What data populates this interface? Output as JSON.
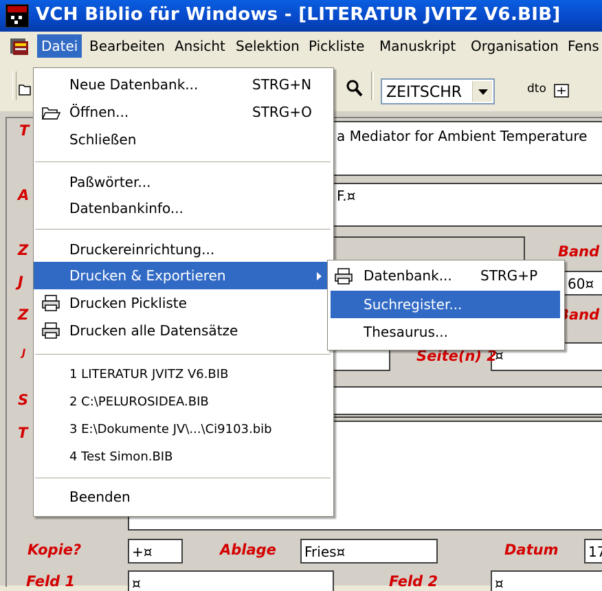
{
  "window": {
    "title": "VCH Biblio für Windows - [LITERATUR JVITZ V6.BIB]"
  },
  "menubar": {
    "items": [
      {
        "label": "Datei"
      },
      {
        "label": "Bearbeiten"
      },
      {
        "label": "Ansicht"
      },
      {
        "label": "Selektion"
      },
      {
        "label": "Pickliste"
      },
      {
        "label": "Manuskript"
      },
      {
        "label": "Organisation"
      },
      {
        "label": "Fens"
      }
    ]
  },
  "toolbar": {
    "field_combo_value": "ZEITSCHR",
    "dto_label": "dto"
  },
  "datei_menu": {
    "new_db": {
      "label": "Neue Datenbank...",
      "shortcut": "STRG+N"
    },
    "open": {
      "label": "Öffnen...",
      "shortcut": "STRG+O"
    },
    "close": {
      "label": "Schließen"
    },
    "passwords": {
      "label": "Paßwörter..."
    },
    "dbinfo": {
      "label": "Datenbankinfo..."
    },
    "printer_setup": {
      "label": "Druckereinrichtung..."
    },
    "print_export": {
      "label": "Drucken & Exportieren"
    },
    "print_picklist": {
      "label": "Drucken Pickliste"
    },
    "print_all": {
      "label": "Drucken alle Datensätze"
    },
    "recent": [
      {
        "label": "1 LITERATUR JVITZ V6.BIB"
      },
      {
        "label": "2 C:\\PELUROSIDEA.BIB"
      },
      {
        "label": "3 E:\\Dokumente JV\\...\\Ci9103.bib"
      },
      {
        "label": "4 Test Simon.BIB"
      }
    ],
    "exit": {
      "label": "Beenden"
    }
  },
  "export_submenu": {
    "database": {
      "label": "Datenbank...",
      "shortcut": "STRG+P"
    },
    "search_index": {
      "label": "Suchregister..."
    },
    "thesaurus": {
      "label": "Thesaurus..."
    }
  },
  "form": {
    "title_text": "a Mediator for Ambient Temperature",
    "author_text": "F.¤",
    "labels": {
      "band1": "Band",
      "band2": "Band",
      "seiten2": "Seite(n) 2",
      "kopie": "Kopie?",
      "ablage": "Ablage",
      "datum": "Datum",
      "feld1": "Feld 1",
      "feld2": "Feld 2",
      "t": "T",
      "a": "A",
      "z1": "Z",
      "j1": "J",
      "z2": "Z",
      "j2": "J",
      "s": "S",
      "t2": "T"
    },
    "values": {
      "jahr_value": "60¤",
      "seiten2_value": "¤",
      "kopie_value": "+¤",
      "ablage_value": "Fries¤",
      "datum_value": "17",
      "feld1_value": "¤",
      "feld2_value": "¤"
    }
  },
  "colors": {
    "titlebar": "#0a5ee0",
    "highlight": "#316ac5",
    "label_red": "#d40000"
  }
}
